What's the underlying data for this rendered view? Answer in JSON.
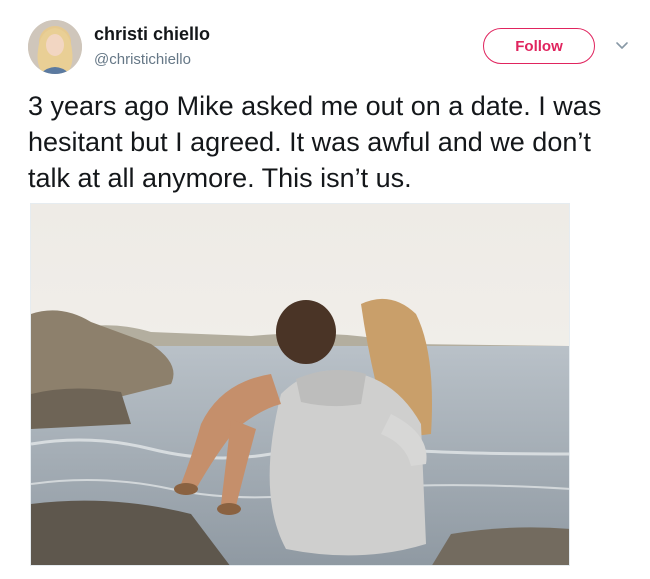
{
  "tweet": {
    "author": {
      "display_name": "christi chiello",
      "handle": "@christichiello",
      "avatar_icon": "profile-avatar"
    },
    "follow_label": "Follow",
    "menu_icon": "chevron-down-icon",
    "text": "3 years ago Mike asked me out on a date. I was hesitant but I agreed. It was awful and we don’t talk at all anymore. This isn’t us.",
    "photo": {
      "description_icon": "beach-couple-photo"
    }
  },
  "colors": {
    "follow_accent": "#e0245e",
    "handle_gray": "#657786",
    "text_dark": "#14171a"
  }
}
